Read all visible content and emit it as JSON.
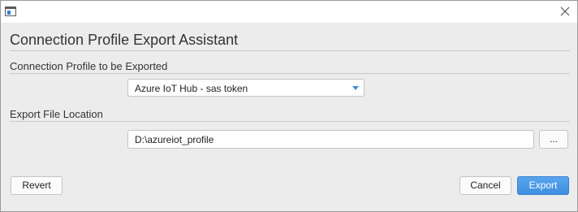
{
  "window": {
    "app_icon": "window-app-icon",
    "close_icon": "close-icon"
  },
  "dialog": {
    "title": "Connection Profile Export Assistant"
  },
  "profile_section": {
    "label": "Connection Profile to be Exported",
    "selected_profile": "Azure IoT Hub - sas token",
    "dropdown_icon": "chevron-down-icon"
  },
  "location_section": {
    "label": "Export File Location",
    "path_value": "D:\\azureiot_profile",
    "browse_label": "..."
  },
  "footer": {
    "revert_label": "Revert",
    "cancel_label": "Cancel",
    "export_label": "Export"
  },
  "colors": {
    "accent": "#3d8ee0",
    "background": "#ececec"
  }
}
